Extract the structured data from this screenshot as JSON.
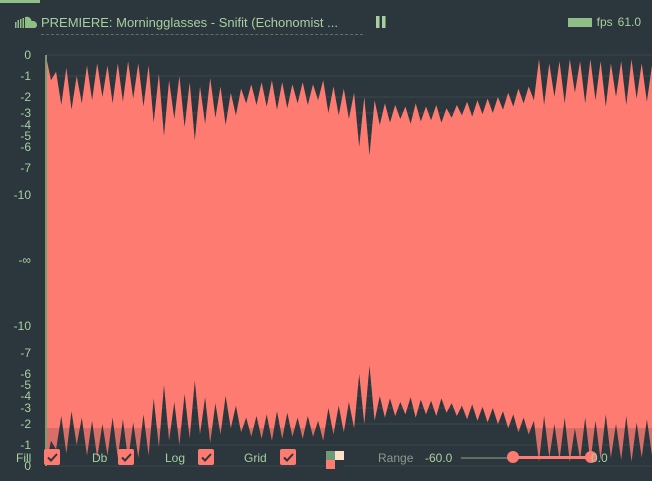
{
  "header": {
    "title": "PREMIERE: Morningglasses - Snifit (Echonomist ...",
    "fps_label": "fps",
    "fps_value": "61.0",
    "source_icon": "soundcloud-icon",
    "pause_icon": "pause-icon"
  },
  "colors": {
    "background": "#2c373d",
    "waveform_fill": "#fe7b72",
    "accent_green": "#8fbf86",
    "text": "#a8cfa0",
    "grid": "#3a474d"
  },
  "chart_data": {
    "type": "area",
    "y_axis": {
      "scale": "dB mirrored (peak at top and bottom, silence at center)",
      "top_ticks": [
        "0",
        "-1",
        "-2",
        "-3",
        "-4",
        "-5",
        "-6",
        "-7",
        "-10"
      ],
      "center_tick": "-∞",
      "bottom_ticks": [
        "-10",
        "-7",
        "-6",
        "-5",
        "-4",
        "-3",
        "-2",
        "-1",
        "0"
      ]
    },
    "grid": true,
    "fill": true,
    "envelope_db": [
      -1.2,
      -0.8,
      -2.5,
      -0.6,
      -2.8,
      -1.0,
      -2.4,
      -0.5,
      -2.2,
      -0.4,
      -2.0,
      -0.5,
      -2.4,
      -0.4,
      -2.3,
      -0.3,
      -2.1,
      -0.4,
      -2.6,
      -0.5,
      -3.8,
      -0.9,
      -5.0,
      -1.2,
      -3.5,
      -1.0,
      -4.2,
      -1.3,
      -5.4,
      -1.5,
      -3.9,
      -1.1,
      -3.4,
      -1.5,
      -4.0,
      -1.8,
      -3.2,
      -1.6,
      -2.4,
      -1.4,
      -2.5,
      -1.3,
      -2.6,
      -1.2,
      -2.8,
      -1.3,
      -2.7,
      -1.4,
      -2.4,
      -1.3,
      -2.5,
      -1.4,
      -2.2,
      -1.2,
      -3.0,
      -1.5,
      -3.2,
      -1.6,
      -3.5,
      -1.8,
      -6.0,
      -2.0,
      -6.4,
      -2.2,
      -4.0,
      -2.4,
      -3.8,
      -2.5,
      -3.5,
      -2.6,
      -3.9,
      -2.4,
      -3.7,
      -2.6,
      -3.6,
      -2.5,
      -3.8,
      -2.7,
      -3.4,
      -2.5,
      -3.2,
      -2.3,
      -3.3,
      -2.2,
      -3.1,
      -2.1,
      -3.0,
      -2.0,
      -2.8,
      -1.8,
      -2.6,
      -1.6,
      -2.4,
      -1.5,
      -2.2,
      -0.2,
      -2.5,
      -0.4,
      -2.0,
      -0.3,
      -2.4,
      -0.2,
      -1.8,
      -0.3,
      -2.4,
      -0.2,
      -2.2,
      -0.3,
      -2.6,
      -0.4,
      -2.0,
      -0.3,
      -2.5,
      -0.2,
      -2.1,
      -0.4,
      -2.3,
      -0.5
    ]
  },
  "controls": {
    "fill_label": "Fill",
    "db_label": "Db",
    "log_label": "Log",
    "grid_label": "Grid",
    "range_label": "Range",
    "range_min": "-60.0",
    "range_max": "0.0",
    "range_low_fraction": 0.4,
    "range_high_fraction": 1.0,
    "fill_checked": true,
    "db_checked": true,
    "log_checked": true,
    "grid_checked": true,
    "swatch_colors": [
      "#6c9a75",
      "#fce0c8",
      "#fe7b72",
      "#2c373d"
    ]
  }
}
